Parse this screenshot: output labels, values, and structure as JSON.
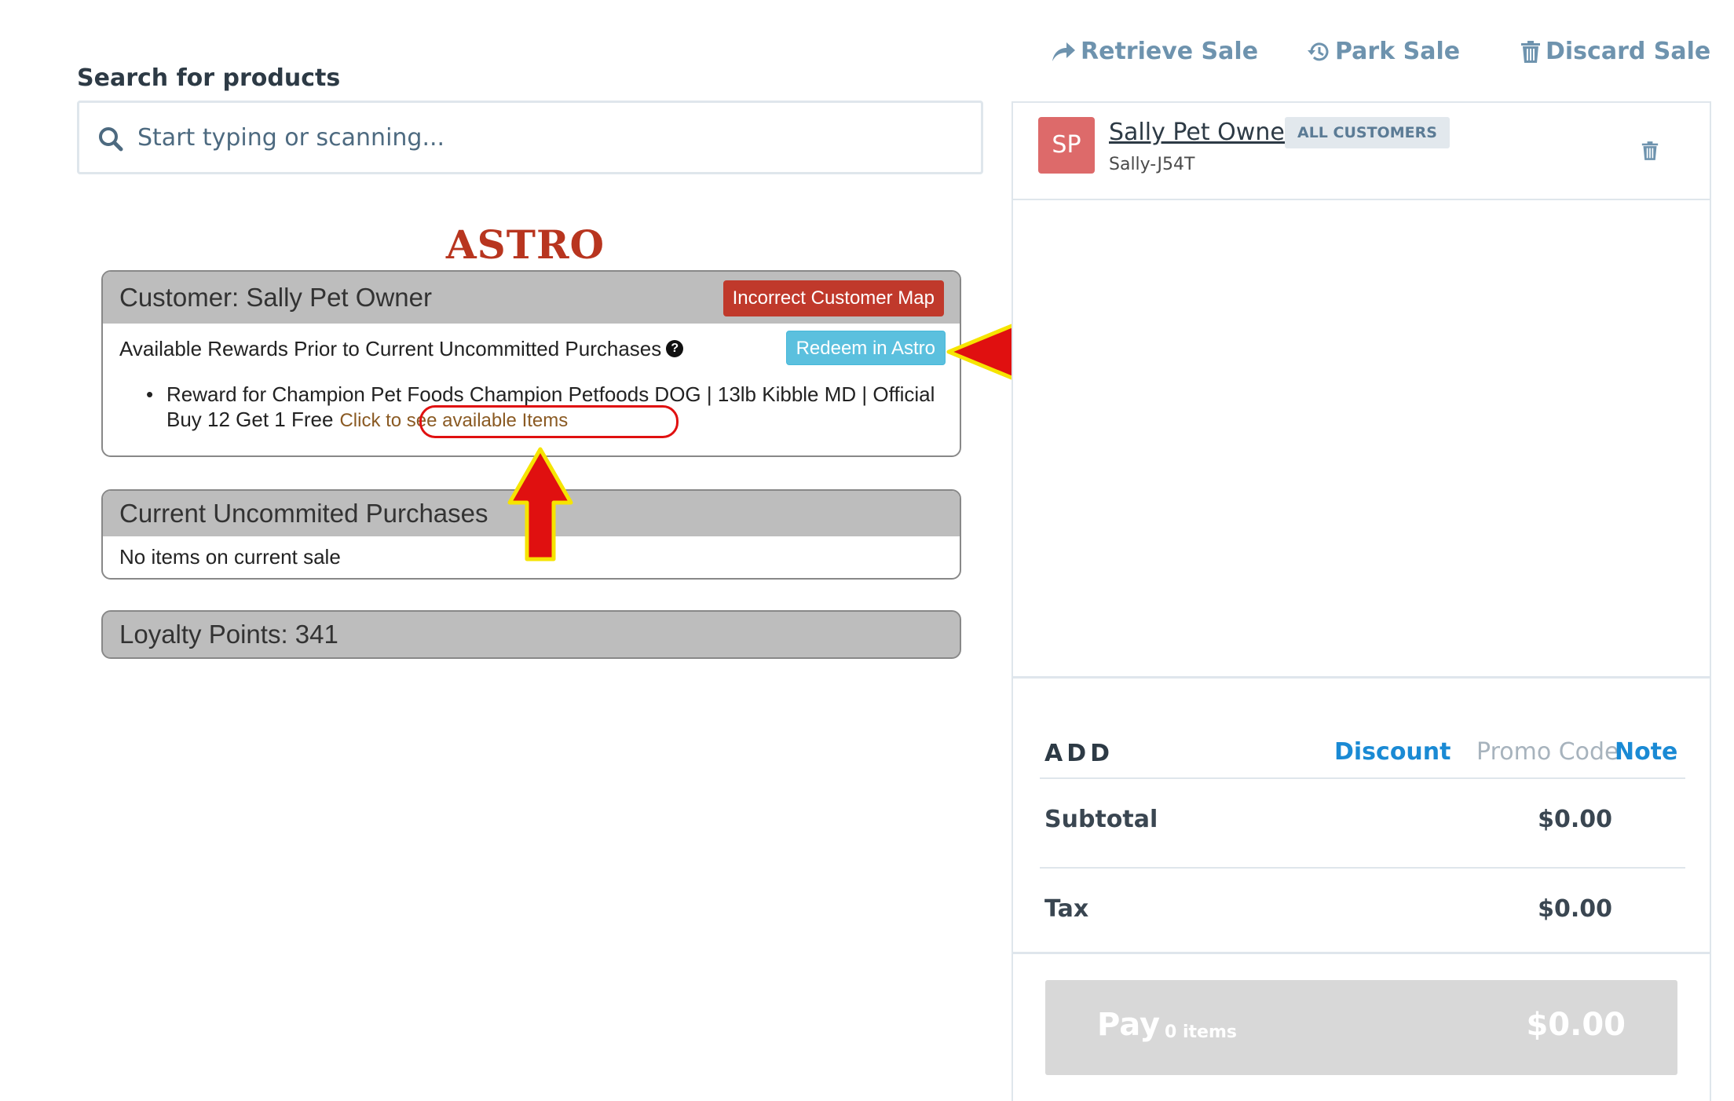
{
  "search": {
    "label": "Search for products",
    "placeholder": "Start typing or scanning..."
  },
  "astro": {
    "logo_text": "ASTRO",
    "customer_title": "Customer: Sally Pet Owner",
    "incorrect_map_label": "Incorrect Customer Map",
    "rewards_heading": "Available Rewards Prior to Current Uncommitted Purchases",
    "help_icon": "question-circle-icon",
    "redeem_label": "Redeem in Astro",
    "reward_item_text": "Reward for Champion Pet Foods Champion Petfoods DOG | 13lb Kibble MD | Official Buy 12 Get 1 Free",
    "see_items_label": "Click to see available Items",
    "uncommitted_title": "Current Uncommited Purchases",
    "uncommitted_empty": "No items on current sale",
    "loyalty_label": "Loyalty Points: 341"
  },
  "actions": {
    "retrieve": "Retrieve Sale",
    "park": "Park Sale",
    "discard": "Discard Sale"
  },
  "customer": {
    "initials": "SP",
    "name": "Sally Pet Owner",
    "badge": "ALL CUSTOMERS",
    "code": "Sally-J54T"
  },
  "totals": {
    "add_label": "ADD",
    "discount": "Discount",
    "promo_code": "Promo Code",
    "note": "Note",
    "subtotal_label": "Subtotal",
    "subtotal_value": "$0.00",
    "tax_label": "Tax",
    "tax_value": "$0.00"
  },
  "pay": {
    "label": "Pay",
    "items": "0 items",
    "amount": "$0.00"
  },
  "colors": {
    "accent_blue": "#1a8ad4",
    "muted_link": "#a7b3bd",
    "action_blue": "#6e93ae",
    "danger": "#c0392b",
    "info": "#5bc0de",
    "annotation_red": "#e01010",
    "annotation_yellow": "#f6e400"
  }
}
